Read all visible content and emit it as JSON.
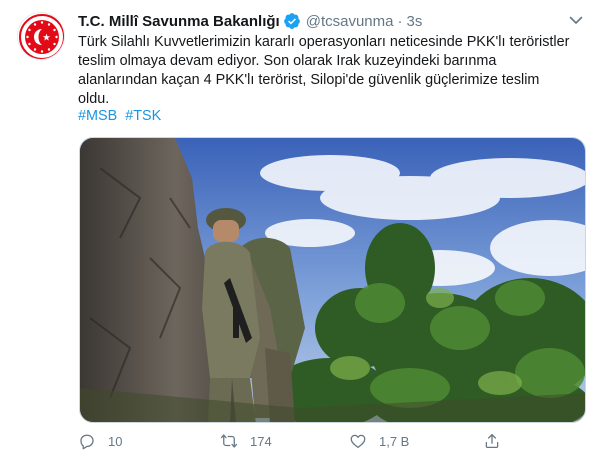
{
  "account": {
    "name": "T.C. Millî Savunma Bakanlığı",
    "handle": "@tcsavunma",
    "separator": "·",
    "time": "3s",
    "avatar_icon": "msb-emblem-icon",
    "verified_icon": "verified-badge-icon"
  },
  "tweet": {
    "text_lines": [
      "Türk Silahlı Kuvvetlerimizin kararlı operasyonları neticesinde PKK'lı teröristler",
      "teslim olmaya devam ediyor. Son olarak Irak kuzeyindeki barınma",
      "alanlarından kaçan 4 PKK'lı terörist, Silopi'de güvenlik güçlerimize teslim",
      "oldu."
    ],
    "hashtags": [
      "#MSB",
      "#TSK"
    ]
  },
  "actions": {
    "reply_count": "10",
    "retweet_count": "174",
    "like_count": "1,7 B",
    "share_icon": "share-icon"
  },
  "colors": {
    "link": "#1b95e0",
    "secondary_text": "#657786",
    "primary_text": "#14171a",
    "emblem_red": "#e30a17",
    "verified_blue": "#1da1f2"
  }
}
